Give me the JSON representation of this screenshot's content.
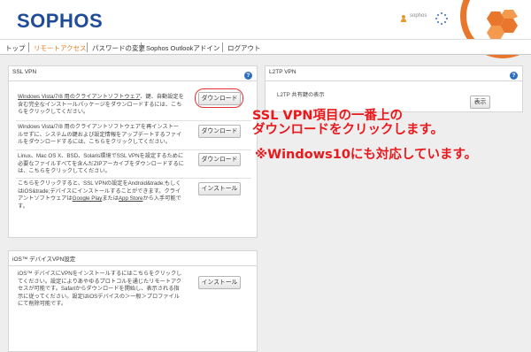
{
  "header": {
    "logo": "SOPHOS",
    "username": "sophos"
  },
  "nav": {
    "items": [
      "トップ",
      "リモートアクセス",
      "パスワードの変更",
      "Sophos Outlookアドイン",
      "ログアウト"
    ]
  },
  "ssl_panel": {
    "title": "SSL VPN",
    "help_glyph": "?",
    "rows": [
      {
        "link_text": "Windows Vista/7/8 用のクライアントソフトウェア",
        "text_after_link": "、鍵、自動設定を含む完全なインストールパッケージをダウンロードするには、こちらをクリックしてください。",
        "button": "ダウンロード"
      },
      {
        "text": "Windows Vista/7/8 用のクライアントソフトウェアを再インストールせずに、システムの鍵および設定情報をアップデートするファイルをダウンロードするには、こちらをクリックしてください。",
        "button": "ダウンロード"
      },
      {
        "text": "Linux、Mac OS X、BSD、Solaris環境でSSL VPNを設定するために必要なファイルすべてを含んだZIPアーカイブをダウンロードするには、こちらをクリックしてください。",
        "button": "ダウンロード"
      },
      {
        "text_prefix": "こちらをクリックすると、SSL VPNの設定をAndroid&trade;もしくはiOS&trade;デバイスにインストールすることができます。クライアントソフトウェアは",
        "link1": "Google Play",
        "text_mid": "または",
        "link2": "App Store",
        "text_suffix": "から入手可能です。",
        "button": "インストール"
      }
    ]
  },
  "ios_panel": {
    "title": "iOS™ デバイスVPN設定",
    "text": "iOS™ デバイスにVPNをインストールするにはこちらをクリックしてください。設定によりあやゆるプロトコルを通じたリモートアクセスが可能です。Safariからダウンロードを開始し、表示される指示に従ってください。設定はiOSデバイスの＞一般＞プロファイルにて削除可能です。",
    "button": "インストール"
  },
  "l2tp_panel": {
    "title": "L2TP VPN",
    "help_glyph": "?",
    "text": "L2TP 共有鍵の表示",
    "button": "表示"
  },
  "annotations": {
    "line1": "SSL VPN項目の一番上の",
    "line2": "ダウンロードをクリックします。",
    "line3": "※Windows10にも対応しています。"
  },
  "colors": {
    "accent": "#e07a1f",
    "annotation": "#e8191d",
    "logo": "#1f4b99",
    "help": "#2f6fc0"
  },
  "icons": {
    "user": "user-icon",
    "activity": "spinner-icon",
    "help": "help-icon",
    "brand": "sophos-badge-icon"
  }
}
